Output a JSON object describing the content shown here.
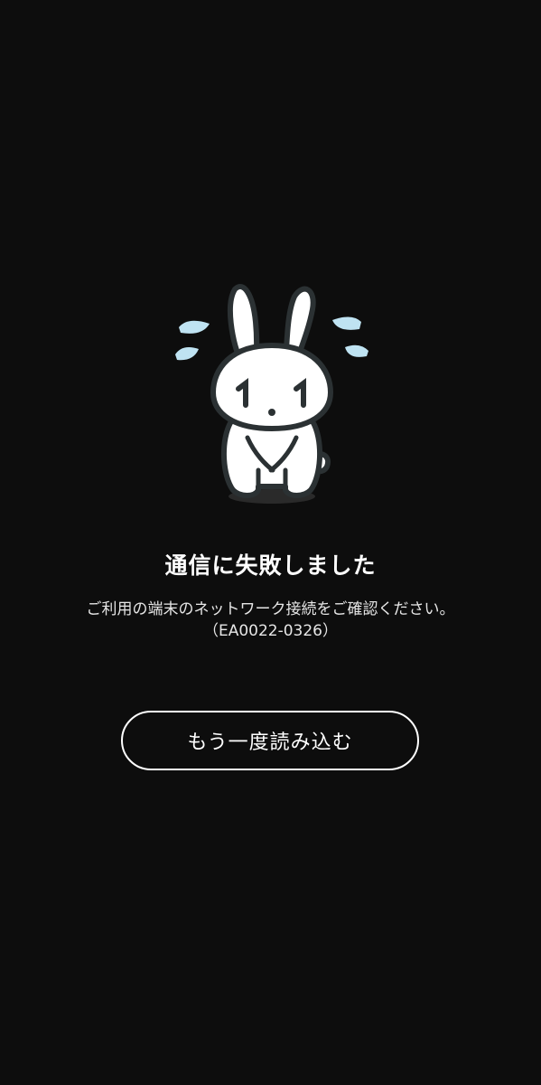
{
  "error": {
    "title": "通信に失敗しました",
    "message": "ご利用の端末のネットワーク接続をご確認ください。",
    "code": "（EA0022-0326）"
  },
  "actions": {
    "reload_label": "もう一度読み込む"
  },
  "mascot": {
    "icon": "crying-rabbit-mascot-icon",
    "body_color": "#ffffff",
    "outline_color": "#2b3133",
    "sweat_color": "#bfe3f2"
  },
  "colors": {
    "background": "#0d0d0d",
    "text": "#ffffff"
  }
}
